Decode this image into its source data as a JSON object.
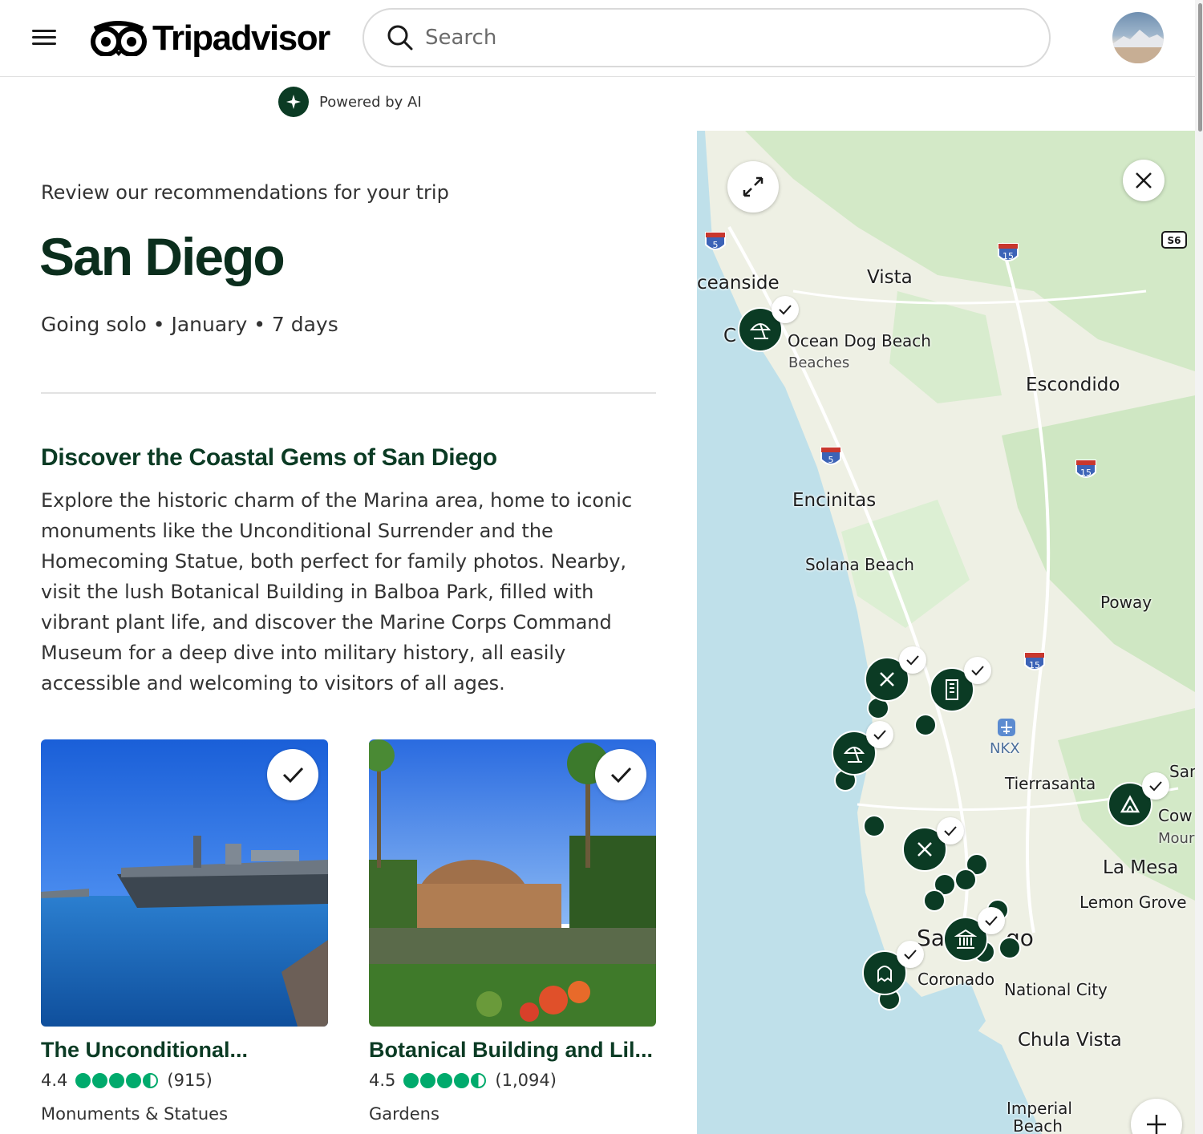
{
  "header": {
    "brand": "Tripadvisor",
    "search_placeholder": "Search"
  },
  "ai_badge": "Powered by AI",
  "trip": {
    "subtitle": "Review our recommendations for your trip",
    "destination": "San Diego",
    "meta": "Going solo • January • 7 days"
  },
  "section": {
    "title": "Discover the Coastal Gems of San Diego",
    "body": "Explore the historic charm of the Marina area, home to iconic monuments like the Unconditional Surrender and the Homecoming Statue, both perfect for family photos. Nearby, visit the lush Botanical Building in Balboa Park, filled with vibrant plant life, and discover the Marine Corps Command Museum for a deep dive into military history, all easily accessible and welcoming to visitors of all ages."
  },
  "cards": [
    {
      "name": "The Unconditional...",
      "rating": "4.4",
      "reviews": "(915)",
      "category": "Monuments & Statues",
      "bubbles": 4.4
    },
    {
      "name": "Botanical Building and Lil...",
      "rating": "4.5",
      "reviews": "(1,094)",
      "category": "Gardens",
      "bubbles": 4.5
    }
  ],
  "map": {
    "labels": {
      "oceanside": "ceanside",
      "vista": "Vista",
      "ocean_dog_beach": "Ocean Dog Beach",
      "beaches": "Beaches",
      "escondido": "Escondido",
      "encinitas": "Encinitas",
      "solana_beach": "Solana Beach",
      "poway": "Poway",
      "nkx": "NKX",
      "tierrasanta": "Tierrasanta",
      "san": "San",
      "la_mesa": "La Mesa",
      "lemon_grove": "Lemon Grove",
      "san_diego_left": "Sa",
      "san_diego_right": "go",
      "coronado": "Coronado",
      "national_city": "National City",
      "chula_vista": "Chula Vista",
      "imperial": "Imperial",
      "beach": "Beach",
      "cow": "Cow",
      "mour": "Mour",
      "c_left": "C"
    },
    "shields": {
      "i5": "5",
      "i15": "15",
      "s6": "S6"
    },
    "colors": {
      "water": "#bfe0ea",
      "land": "#eef0e4",
      "green": "#cfe7c3",
      "pin": "#0b3b24"
    }
  }
}
